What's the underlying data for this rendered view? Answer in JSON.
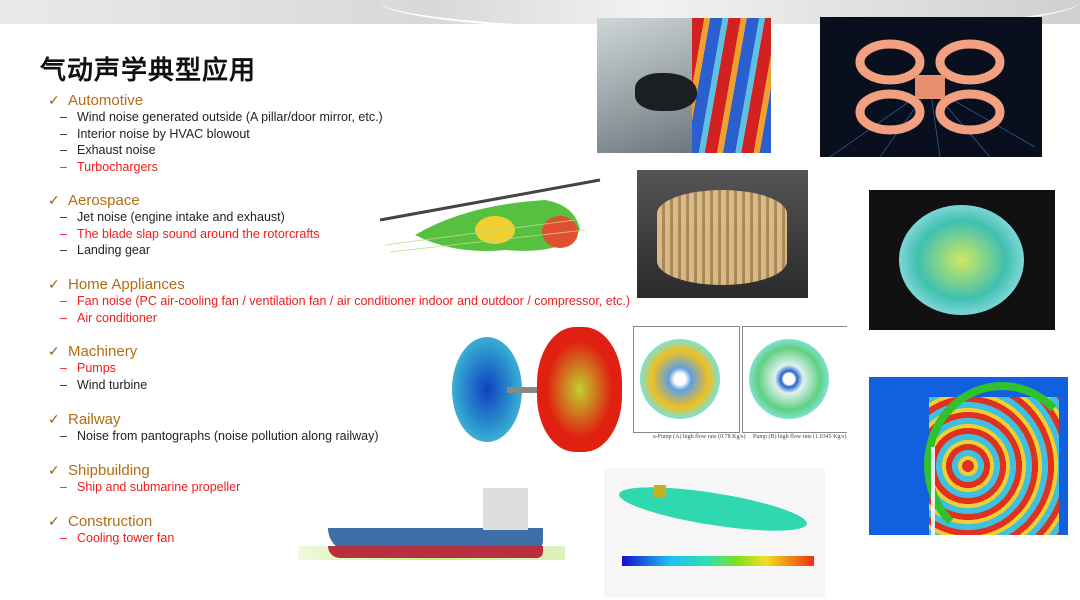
{
  "slide": {
    "title": "气动声学典型应用",
    "check_icon": "✓",
    "dash": "–",
    "colors": {
      "heading": "#b36d12",
      "highlight": "#ee1c1c",
      "normal": "#222222"
    },
    "sections": [
      {
        "heading": "Automotive",
        "items": [
          {
            "text": "Wind noise generated outside (A pillar/door mirror, etc.)",
            "highlight": false
          },
          {
            "text": "Interior noise by HVAC blowout",
            "highlight": false
          },
          {
            "text": "Exhaust noise",
            "highlight": false
          },
          {
            "text": "Turbochargers",
            "highlight": true
          }
        ]
      },
      {
        "heading": "Aerospace",
        "items": [
          {
            "text": "Jet noise (engine intake and exhaust)",
            "highlight": false
          },
          {
            "text": "The blade slap sound around the rotorcrafts",
            "highlight": true
          },
          {
            "text": "Landing gear",
            "highlight": false
          }
        ]
      },
      {
        "heading": "Home Appliances",
        "items": [
          {
            "text": "Fan noise (PC air-cooling fan / ventilation fan / air conditioner indoor and outdoor / compressor, etc.)",
            "highlight": true
          },
          {
            "text": "Air conditioner",
            "highlight": true
          }
        ]
      },
      {
        "heading": "Machinery",
        "items": [
          {
            "text": "Pumps",
            "highlight": true
          },
          {
            "text": "Wind turbine",
            "highlight": false
          }
        ]
      },
      {
        "heading": "Railway",
        "items": [
          {
            "text": "Noise from pantographs (noise pollution along railway)",
            "highlight": false
          }
        ]
      },
      {
        "heading": "Shipbuilding",
        "items": [
          {
            "text": "Ship and submarine propeller",
            "highlight": true
          }
        ]
      },
      {
        "heading": "Construction",
        "items": [
          {
            "text": "Cooling tower fan",
            "highlight": true
          }
        ]
      }
    ]
  },
  "figures": {
    "pump_captions": [
      "a-Pump (A) high flow rate (0.78 Kg/s)",
      "Pump (B) high flow rate (1.0345 Kg/s)"
    ]
  }
}
